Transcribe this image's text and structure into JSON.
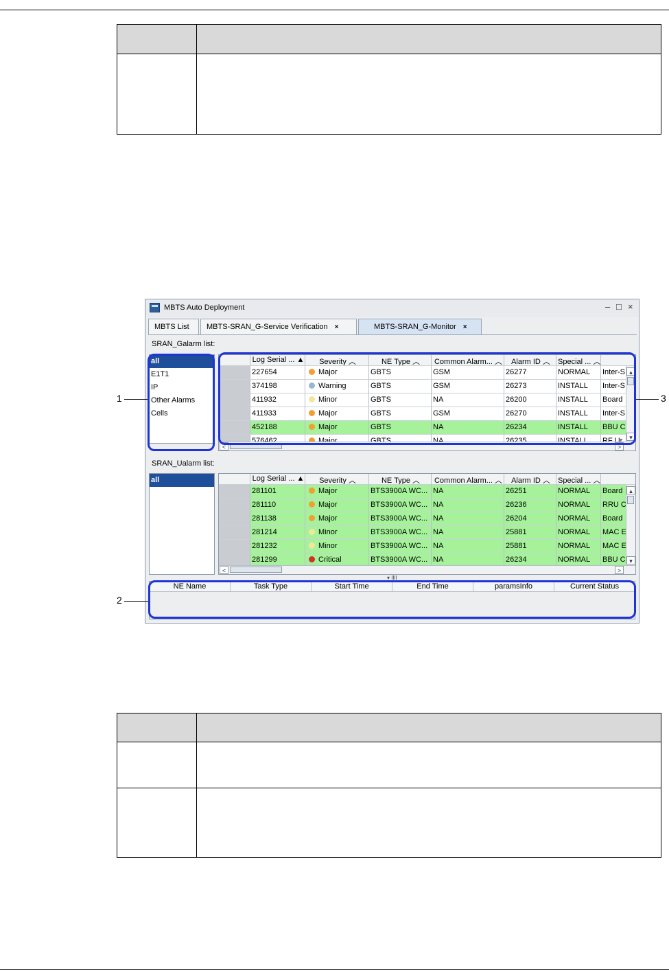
{
  "window": {
    "title": "MBTS Auto Deployment",
    "controls": [
      "–",
      "□",
      "×"
    ],
    "tabs": [
      {
        "label": "MBTS List",
        "closable": false
      },
      {
        "label": "MBTS-SRAN_G-Service  Verification",
        "closable": true
      },
      {
        "label": "MBTS-SRAN_G-Monitor",
        "closable": true,
        "active": true
      }
    ],
    "close_glyph": "×"
  },
  "galarm": {
    "label": "SRAN_Galarm list:",
    "categories": [
      "all",
      "E1T1",
      "IP",
      "Other Alarms",
      "Cells"
    ],
    "columns": [
      "",
      "Log Serial ... ▲",
      "Severity ︿",
      "NE Type ︿",
      "Common Alarm... ︿",
      "Alarm ID ︿",
      "Special ... ︿",
      ""
    ],
    "rows": [
      {
        "serial": "227654",
        "severity": "Major",
        "sev_color": "#f0a030",
        "ne": "GBTS",
        "common": "GSM",
        "id": "26277",
        "special": "NORMAL",
        "extra": "Inter-S",
        "bg": "white"
      },
      {
        "serial": "374198",
        "severity": "Warning",
        "sev_color": "#9ab7d0",
        "ne": "GBTS",
        "common": "GSM",
        "id": "26273",
        "special": "INSTALL",
        "extra": "Inter-S",
        "bg": "white"
      },
      {
        "serial": "411932",
        "severity": "Minor",
        "sev_color": "#f3e69a",
        "ne": "GBTS",
        "common": "NA",
        "id": "26200",
        "special": "INSTALL",
        "extra": "Board",
        "bg": "white"
      },
      {
        "serial": "411933",
        "severity": "Major",
        "sev_color": "#f0a030",
        "ne": "GBTS",
        "common": "GSM",
        "id": "26270",
        "special": "INSTALL",
        "extra": "Inter-S",
        "bg": "white"
      },
      {
        "serial": "452188",
        "severity": "Major",
        "sev_color": "#f0a030",
        "ne": "GBTS",
        "common": "NA",
        "id": "26234",
        "special": "INSTALL",
        "extra": "BBU C",
        "bg": "green"
      },
      {
        "serial": "576462",
        "severity": "Major",
        "sev_color": "#f0a030",
        "ne": "GBTS",
        "common": "NA",
        "id": "26235",
        "special": "INSTALL",
        "extra": "RF Ur",
        "bg": "white"
      }
    ]
  },
  "ualarm": {
    "label": "SRAN_Ualarm list:",
    "categories": [
      "all"
    ],
    "columns": [
      "",
      "Log Serial ... ▲",
      "Severity ︿",
      "NE Type ︿",
      "Common Alarm... ︿",
      "Alarm ID ︿",
      "Special ... ︿",
      ""
    ],
    "rows": [
      {
        "serial": "281101",
        "severity": "Major",
        "sev_color": "#f0a030",
        "ne": "BTS3900A WC...",
        "common": "NA",
        "id": "26251",
        "special": "NORMAL",
        "extra": "Board",
        "bg": "green"
      },
      {
        "serial": "281110",
        "severity": "Major",
        "sev_color": "#f0a030",
        "ne": "BTS3900A WC...",
        "common": "NA",
        "id": "26236",
        "special": "NORMAL",
        "extra": "RRU C",
        "bg": "green"
      },
      {
        "serial": "281138",
        "severity": "Major",
        "sev_color": "#f0a030",
        "ne": "BTS3900A WC...",
        "common": "NA",
        "id": "26204",
        "special": "NORMAL",
        "extra": "Board",
        "bg": "green"
      },
      {
        "serial": "281214",
        "severity": "Minor",
        "sev_color": "#f3e69a",
        "ne": "BTS3900A WC...",
        "common": "NA",
        "id": "25881",
        "special": "NORMAL",
        "extra": "MAC E",
        "bg": "green"
      },
      {
        "serial": "281232",
        "severity": "Minor",
        "sev_color": "#f3e69a",
        "ne": "BTS3900A WC...",
        "common": "NA",
        "id": "25881",
        "special": "NORMAL",
        "extra": "MAC E",
        "bg": "green"
      },
      {
        "serial": "281299",
        "severity": "Critical",
        "sev_color": "#d2302a",
        "ne": "BTS3900A WC...",
        "common": "NA",
        "id": "26234",
        "special": "NORMAL",
        "extra": "BBU C",
        "bg": "green"
      }
    ]
  },
  "task": {
    "columns": [
      "NE Name",
      "Task Type",
      "Start Time",
      "End Time",
      "paramsInfo",
      "Current Status"
    ]
  },
  "callouts": [
    "1",
    "2",
    "3"
  ],
  "scroll": {
    "up": "▴",
    "down": "▾",
    "left": "<",
    "right": ">"
  }
}
